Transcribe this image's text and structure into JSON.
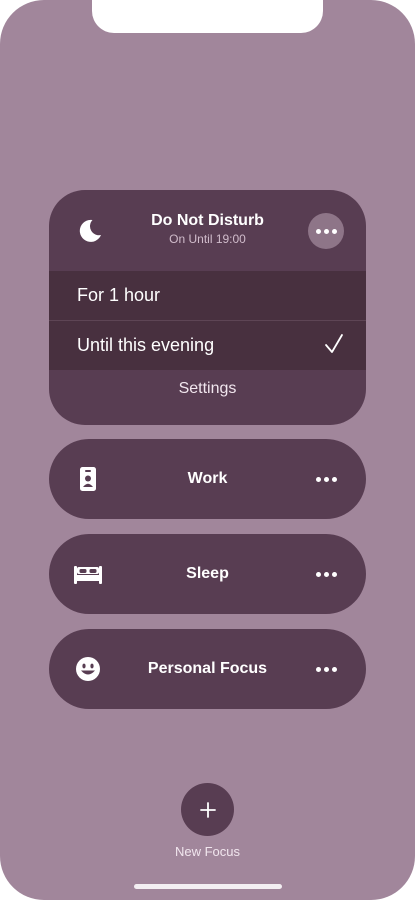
{
  "dnd": {
    "title": "Do Not Disturb",
    "subtitle": "On Until 19:00",
    "icon": "moon-icon",
    "options": [
      {
        "label": "For 1 hour",
        "selected": false
      },
      {
        "label": "Until this evening",
        "selected": true
      }
    ],
    "settings_label": "Settings"
  },
  "focus_modes": [
    {
      "label": "Work",
      "icon": "id-badge-icon"
    },
    {
      "label": "Sleep",
      "icon": "bed-icon"
    },
    {
      "label": "Personal Focus",
      "icon": "smiley-icon"
    }
  ],
  "new_focus": {
    "label": "New Focus",
    "icon": "plus-icon"
  },
  "colors": {
    "background": "#a1869b",
    "card": "#583d52",
    "option_row": "#48303f",
    "accent_circle": "#8e7588"
  }
}
